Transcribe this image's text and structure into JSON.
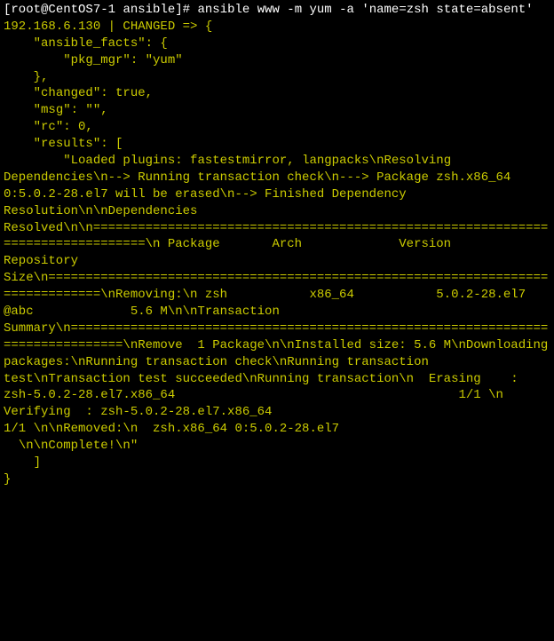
{
  "prompt": {
    "user": "root",
    "host": "CentOS7-1",
    "cwd": "ansible"
  },
  "command": "ansible www -m yum -a 'name=zsh state=absent'",
  "output": {
    "line1": "192.168.6.130 | CHANGED => {",
    "line2": "    \"ansible_facts\": {",
    "line3": "        \"pkg_mgr\": \"yum\"",
    "line4": "    },",
    "line5": "    \"changed\": true,",
    "line6": "    \"msg\": \"\",",
    "line7": "    \"rc\": 0,",
    "line8": "    \"results\": [",
    "line9": "        \"Loaded plugins: fastestmirror, langpacks\\nResolving Dependencies\\n--> Running transaction check\\n---> Package zsh.x86_64 0:5.0.2-28.el7 will be erased\\n--> Finished Dependency Resolution\\n\\nDependencies Resolved\\n\\n================================================================================\\n Package       Arch             Version                 Repository        Size\\n================================================================================\\nRemoving:\\n zsh           x86_64           5.0.2-28.el7            @abc             5.6 M\\n\\nTransaction Summary\\n================================================================================\\nRemove  1 Package\\n\\nInstalled size: 5.6 M\\nDownloading packages:\\nRunning transaction check\\nRunning transaction test\\nTransaction test succeeded\\nRunning transaction\\n  Erasing    : zsh-5.0.2-28.el7.x86_64                                      1/1 \\n  Verifying  : zsh-5.0.2-28.el7.x86_64                                      1/1 \\n\\nRemoved:\\n  zsh.x86_64 0:5.0.2-28.el7                                                     ",
    "line10": "  \\n\\nComplete!\\n\"",
    "line11": "    ]",
    "line12": "}",
    "line13": "",
    "line14": "",
    "line15": ""
  }
}
